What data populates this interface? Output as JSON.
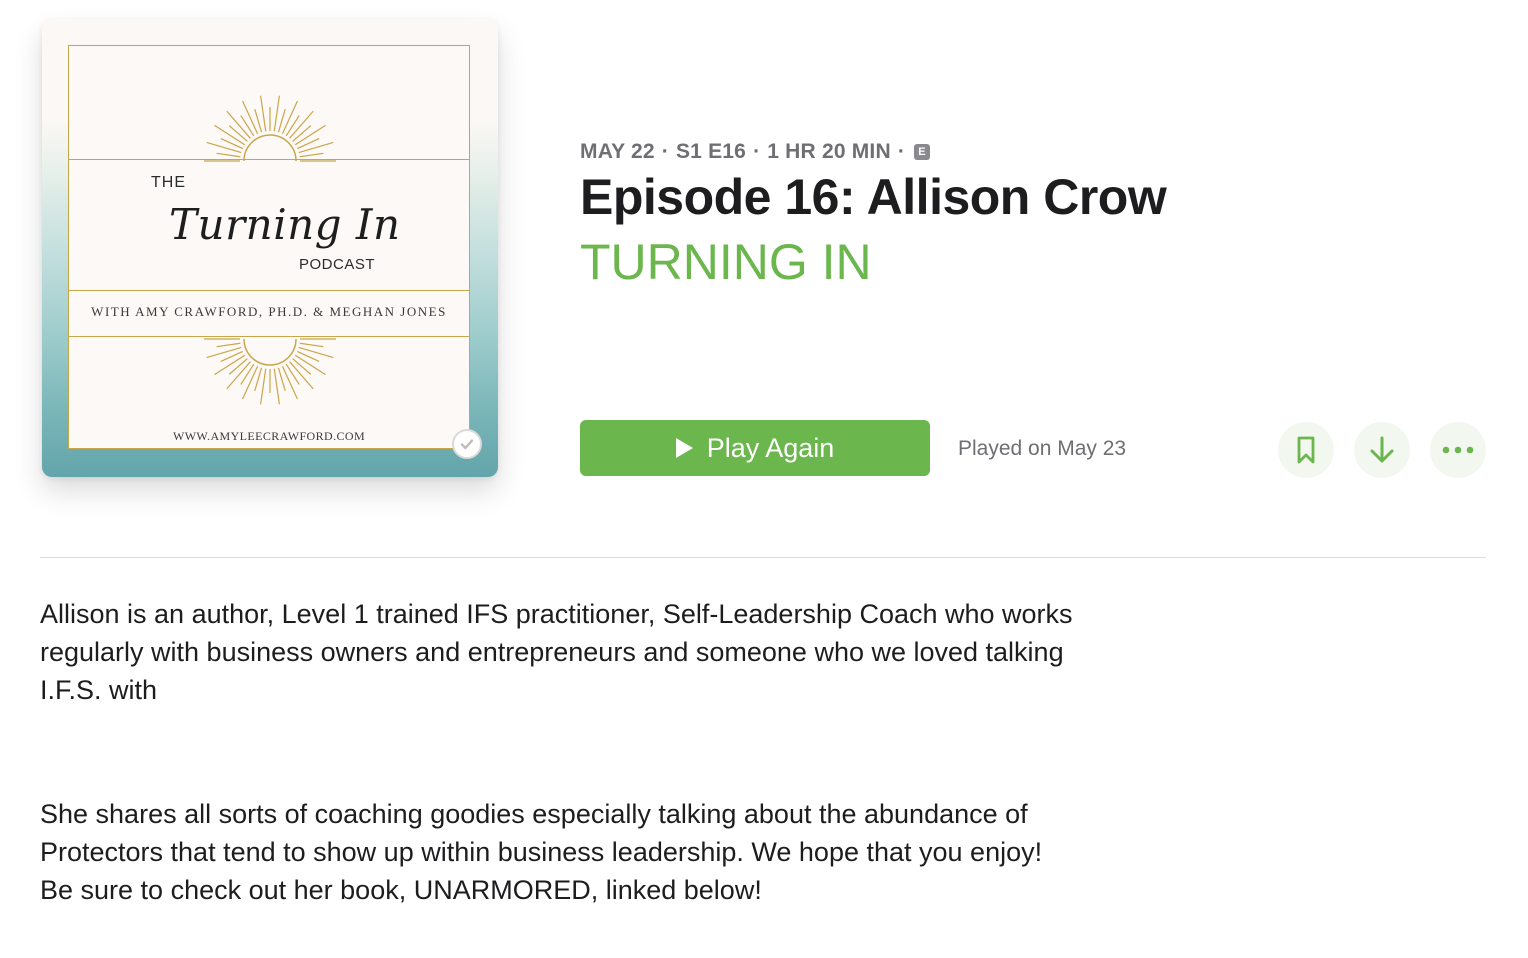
{
  "artwork": {
    "the": "THE",
    "script_title": "Turning In",
    "podcast": "PODCAST",
    "with_line": "WITH AMY CRAWFORD, PH.D. & MEGHAN JONES",
    "url": "WWW.AMYLEECRAWFORD.COM",
    "played_icon": "checkmark-icon"
  },
  "episode": {
    "date": "MAY 22",
    "season_episode": "S1 E16",
    "duration": "1 HR 20 MIN",
    "separator": "·",
    "explicit_badge": "E",
    "title": "Episode 16: Allison Crow",
    "show": "TURNING IN"
  },
  "actions": {
    "play_label": "Play Again",
    "played_on": "Played on May 23",
    "icons": [
      "play-icon",
      "bookmark-icon",
      "download-icon",
      "more-icon"
    ]
  },
  "description": {
    "paragraph1": "Allison is an author, Level 1 trained IFS practitioner, Self-Leadership Coach who works regularly with business owners and entrepreneurs and someone who we loved talking I.F.S. with",
    "paragraph2": "She shares all sorts of coaching goodies especially talking about the abundance of Protectors that tend to show up within business leadership. We hope that you enjoy! Be sure to check out her book, UNARMORED, linked below!"
  },
  "colors": {
    "accent": "#6bb64d",
    "meta_gray": "#6e6e73",
    "gold": "#c9a64a",
    "teal": "#62a5aa"
  }
}
